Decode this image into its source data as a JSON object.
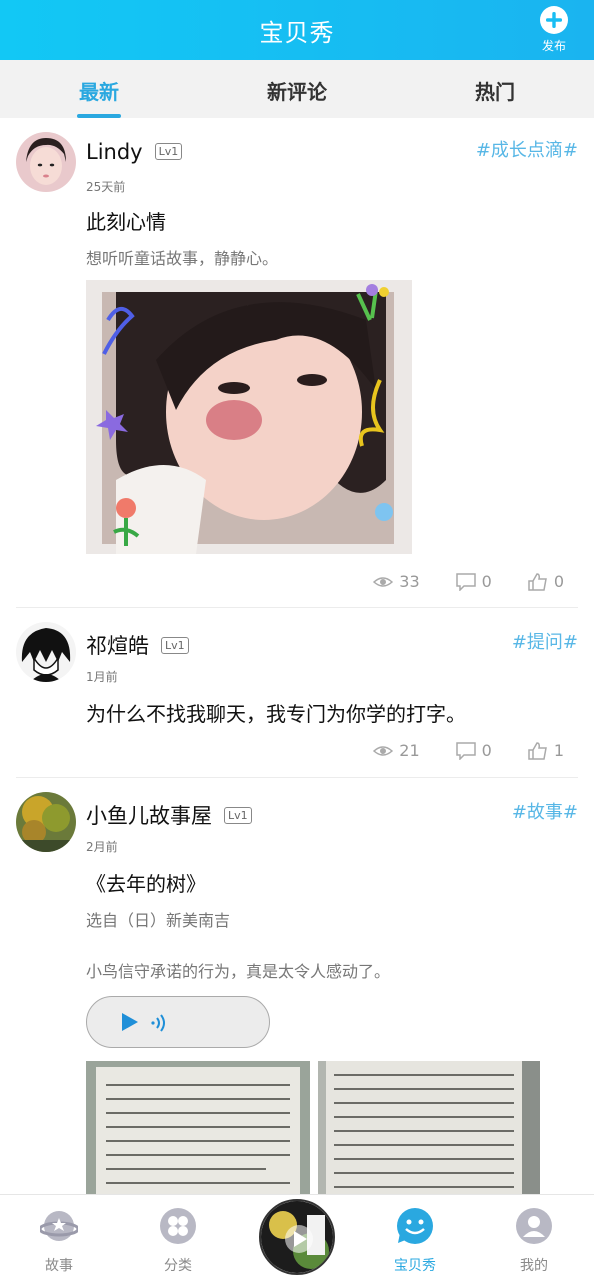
{
  "header": {
    "title": "宝贝秀",
    "publish_label": "发布"
  },
  "tabs": [
    {
      "label": "最新",
      "active": true
    },
    {
      "label": "新评论",
      "active": false
    },
    {
      "label": "热门",
      "active": false
    }
  ],
  "posts": [
    {
      "username": "Lindy",
      "level": "Lv1",
      "time": "25天前",
      "tag": "#成长点滴#",
      "title": "此刻心情",
      "desc": "想听听童话故事，静静心。",
      "views": "33",
      "comments": "0",
      "likes": "0"
    },
    {
      "username": "祁煊皓",
      "level": "Lv1",
      "time": "1月前",
      "tag": "#提问#",
      "title": "为什么不找我聊天，我专门为你学的打字。",
      "views": "21",
      "comments": "0",
      "likes": "1"
    },
    {
      "username": "小鱼儿故事屋",
      "level": "Lv1",
      "time": "2月前",
      "tag": "#故事#",
      "title": "《去年的树》",
      "desc": "选自（日）新美南吉",
      "desc2": "小鸟信守承诺的行为，真是太令人感动了。"
    }
  ],
  "bottom_nav": [
    {
      "label": "故事",
      "icon": "planet-icon",
      "active": false
    },
    {
      "label": "分类",
      "icon": "category-icon",
      "active": false
    },
    {
      "label": "",
      "icon": "play-disc-icon",
      "active": false
    },
    {
      "label": "宝贝秀",
      "icon": "smile-bubble-icon",
      "active": true
    },
    {
      "label": "我的",
      "icon": "user-icon",
      "active": false
    }
  ],
  "colors": {
    "accent": "#2aa8e0",
    "header": "#12c8f5",
    "tag": "#58b7e6"
  }
}
